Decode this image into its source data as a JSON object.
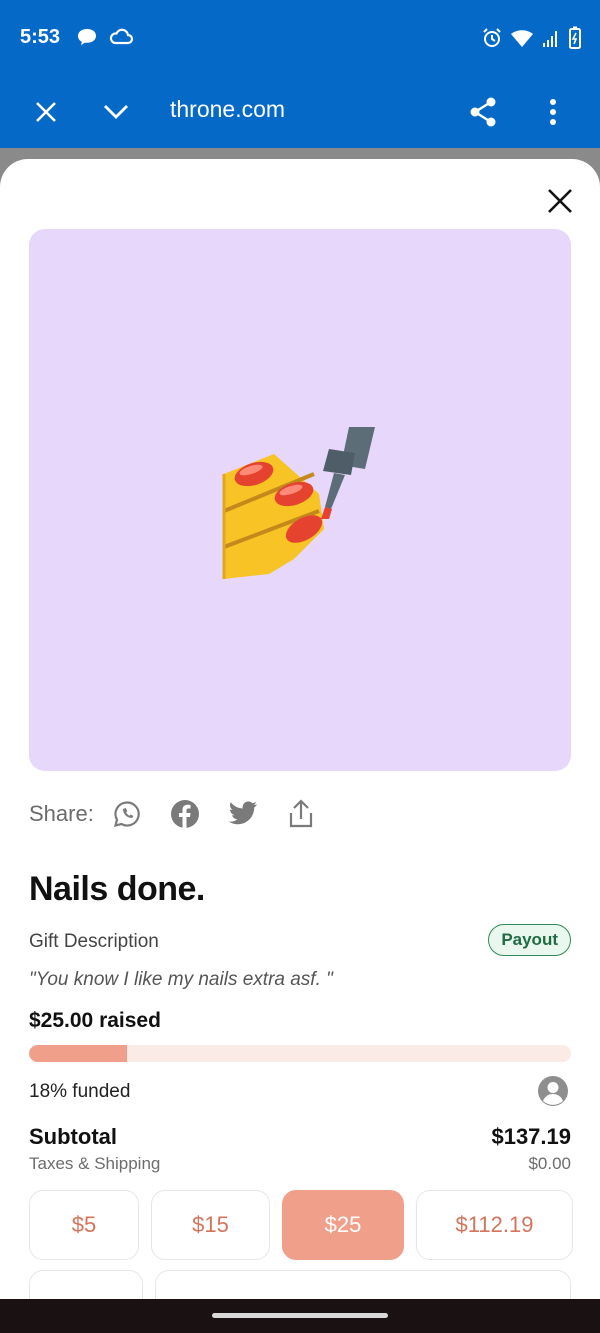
{
  "status": {
    "time": "5:53"
  },
  "browser": {
    "url": "throne.com"
  },
  "share": {
    "label": "Share:"
  },
  "gift": {
    "title": "Nails done.",
    "description_label": "Gift Description",
    "payout_badge": "Payout",
    "quote": "\"You know I like my nails extra asf. \"",
    "raised": "$25.00 raised",
    "funded_percent": 18,
    "funded_label": "18% funded"
  },
  "checkout": {
    "subtotal_label": "Subtotal",
    "subtotal_value": "$137.19",
    "taxes_label": "Taxes & Shipping",
    "taxes_value": "$0.00",
    "amount_options": [
      "$5",
      "$15",
      "$25",
      "$112.19"
    ],
    "selected_amount": "$25"
  },
  "colors": {
    "brand_bar": "#0569c8",
    "accent": "#f0a08a",
    "hero_bg": "#e7d7fb",
    "payout_green": "#2e8a57"
  },
  "icons": [
    "close-icon",
    "chevron-down-icon",
    "share-icon",
    "more-vert-icon",
    "whatsapp-icon",
    "facebook-icon",
    "twitter-icon",
    "upload-icon",
    "nail-polish-icon",
    "user-avatar-icon"
  ]
}
